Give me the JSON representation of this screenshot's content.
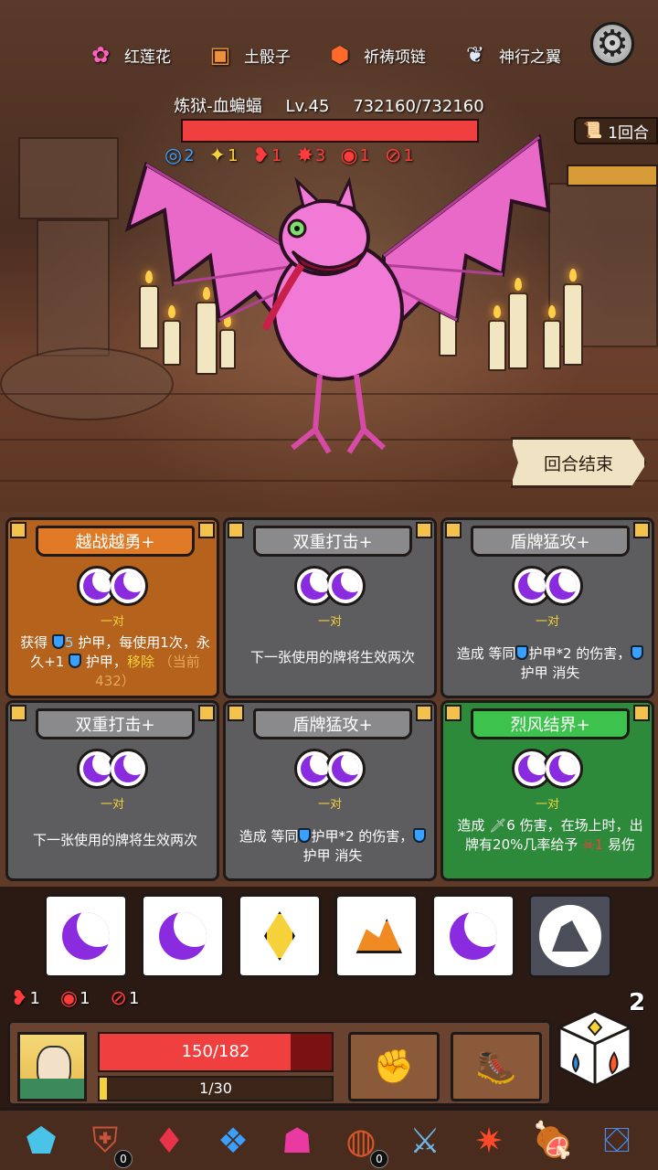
{
  "relics": [
    {
      "name": "红莲花",
      "icon": "lotus-icon"
    },
    {
      "name": "土骰子",
      "icon": "earth-dice-icon"
    },
    {
      "name": "祈祷项链",
      "icon": "prayer-necklace-icon"
    },
    {
      "name": "神行之翼",
      "icon": "wing-icon"
    }
  ],
  "enemy": {
    "name": "炼狱-血蝙蝠",
    "level": "Lv.45",
    "hp_text": "732160/732160",
    "hp_current": 732160,
    "hp_max": 732160,
    "statuses": [
      {
        "icon": "vortex-icon",
        "value": "2",
        "color": "#3aa0ff"
      },
      {
        "icon": "star-icon",
        "value": "1",
        "color": "#f5d23a"
      },
      {
        "icon": "weaken-icon",
        "value": "1",
        "color": "#ff3b3b"
      },
      {
        "icon": "bleed-icon",
        "value": "3",
        "color": "#ff3b3b"
      },
      {
        "icon": "spiral-icon",
        "value": "1",
        "color": "#ff3b3b"
      },
      {
        "icon": "no-attack-icon",
        "value": "1",
        "color": "#ff3b3b"
      }
    ]
  },
  "round": {
    "label": "1回合"
  },
  "end_turn": {
    "label": "回合结束"
  },
  "cards": [
    {
      "title": "越战越勇+",
      "sub": "一对",
      "style": "orange",
      "desc_a": "获得",
      "desc_b": "5",
      "desc_c": "护甲，每使用1次，永久+1",
      "desc_d": "护甲，",
      "desc_e": "移除",
      "desc_f": "（当前432）"
    },
    {
      "title": "双重打击+",
      "sub": "一对",
      "style": "gray",
      "desc": "下一张使用的牌将生效两次"
    },
    {
      "title": "盾牌猛攻+",
      "sub": "一对",
      "style": "gray",
      "desc_a": "造成 等同",
      "desc_b": "护甲*2 的伤害，",
      "desc_c": "护甲 消失"
    },
    {
      "title": "双重打击+",
      "sub": "一对",
      "style": "gray",
      "desc": "下一张使用的牌将生效两次"
    },
    {
      "title": "盾牌猛攻+",
      "sub": "一对",
      "style": "gray",
      "desc_a": "造成 等同",
      "desc_b": "护甲*2 的伤害，",
      "desc_c": "护甲 消失"
    },
    {
      "title": "烈风结界+",
      "sub": "一对",
      "style": "green",
      "desc_a": "造成",
      "desc_b": "6 伤害，在场上时，出牌有20%几率给予",
      "desc_c": "1",
      "desc_d": "易伤"
    }
  ],
  "dice": [
    "moon",
    "moon",
    "diamond",
    "fire",
    "moon",
    "rock"
  ],
  "player_statuses": [
    {
      "icon": "weaken-icon",
      "value": "1"
    },
    {
      "icon": "spiral-icon",
      "value": "1"
    },
    {
      "icon": "no-attack-icon",
      "value": "1"
    }
  ],
  "dice_remaining": "2",
  "player": {
    "hp_text": "150/182",
    "hp_current": 150,
    "hp_max": 182,
    "xp_text": "1/30",
    "xp_current": 1,
    "xp_max": 30
  },
  "items": [
    {
      "icon": "ice-crystal-icon",
      "count": ""
    },
    {
      "icon": "shield-amulet-icon",
      "count": "0"
    },
    {
      "icon": "ruby-pendant-icon",
      "count": ""
    },
    {
      "icon": "blue-crystal-icon",
      "count": ""
    },
    {
      "icon": "demon-mask-icon",
      "count": ""
    },
    {
      "icon": "flame-plate-icon",
      "count": "0"
    },
    {
      "icon": "ice-sword-icon",
      "count": ""
    },
    {
      "icon": "fire-dagger-icon",
      "count": ""
    },
    {
      "icon": "meat-icon",
      "count": ""
    },
    {
      "icon": "relic-box-icon",
      "count": ""
    }
  ]
}
